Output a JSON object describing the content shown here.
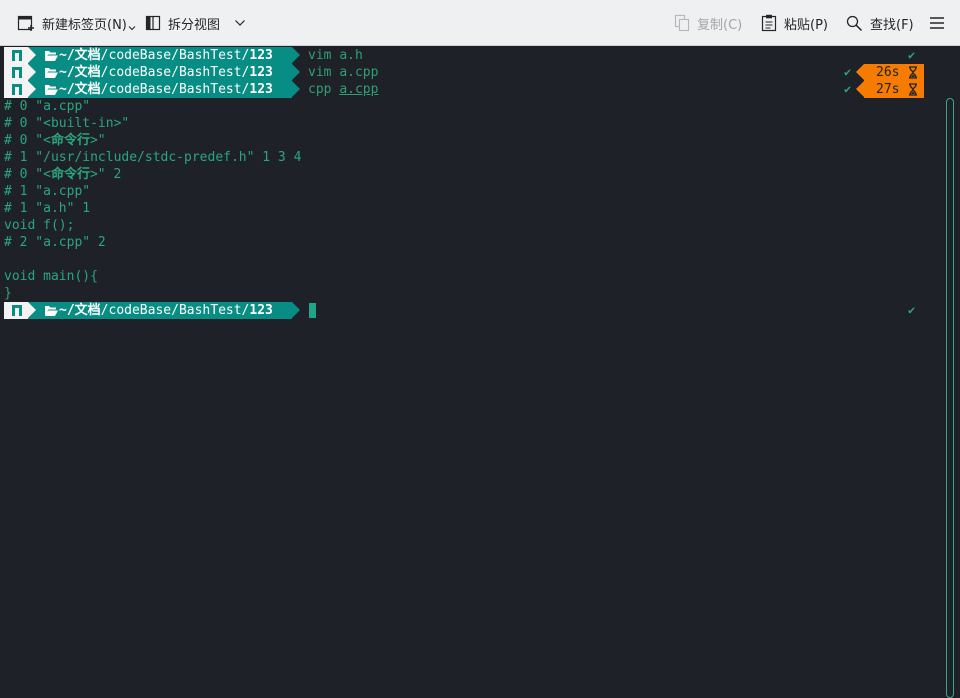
{
  "toolbar": {
    "new_tab_label": "新建标签页(N)",
    "split_view_label": "拆分视图",
    "copy_label": "复制(C)",
    "paste_label": "粘贴(P)",
    "find_label": "查找(F)",
    "icons": [
      "new-tab-icon",
      "split-view-icon",
      "copy-icon",
      "paste-icon",
      "search-icon",
      "hamburger-menu-icon"
    ]
  },
  "prompt": {
    "path_prefix": "~/",
    "path_cjk": "文档",
    "path_mid": "/codeBase/BashTest/",
    "path_dir": "123",
    "os_icon": "distro-logo-icon",
    "folder_icon": "folder-open-icon"
  },
  "history": [
    {
      "cmd": "vim",
      "arg": "a.h",
      "status": "✔",
      "time": ""
    },
    {
      "cmd": "vim",
      "arg": "a.cpp",
      "status": "✔",
      "time": "26s"
    },
    {
      "cmd": "cpp",
      "arg": "a.cpp",
      "status": "✔",
      "time": "27s"
    }
  ],
  "output": [
    {
      "pre": "# 0 \"a.cpp\"",
      "cjk": "",
      "post": ""
    },
    {
      "pre": "# 0 \"<built-in>\"",
      "cjk": "",
      "post": ""
    },
    {
      "pre": "# 0 \"<",
      "cjk": "命令行",
      "post": ">\""
    },
    {
      "pre": "# 1 \"/usr/include/stdc-predef.h\" 1 3 4",
      "cjk": "",
      "post": ""
    },
    {
      "pre": "# 0 \"<",
      "cjk": "命令行",
      "post": ">\" 2"
    },
    {
      "pre": "# 1 \"a.cpp\"",
      "cjk": "",
      "post": ""
    },
    {
      "pre": "# 1 \"a.h\" 1",
      "cjk": "",
      "post": ""
    },
    {
      "pre": "void f();",
      "cjk": "",
      "post": ""
    },
    {
      "pre": "# 2 \"a.cpp\" 2",
      "cjk": "",
      "post": ""
    },
    {
      "pre": "",
      "cjk": "",
      "post": ""
    },
    {
      "pre": "void main(){",
      "cjk": "",
      "post": ""
    },
    {
      "pre": "}",
      "cjk": "",
      "post": ""
    }
  ],
  "current_prompt_status": "✔",
  "colors": {
    "terminal_bg": "#1e2228",
    "prompt_path_bg": "#078d83",
    "output_text": "#2aa57f",
    "timer_bg": "#f57c00",
    "cursor": "#21a589"
  }
}
